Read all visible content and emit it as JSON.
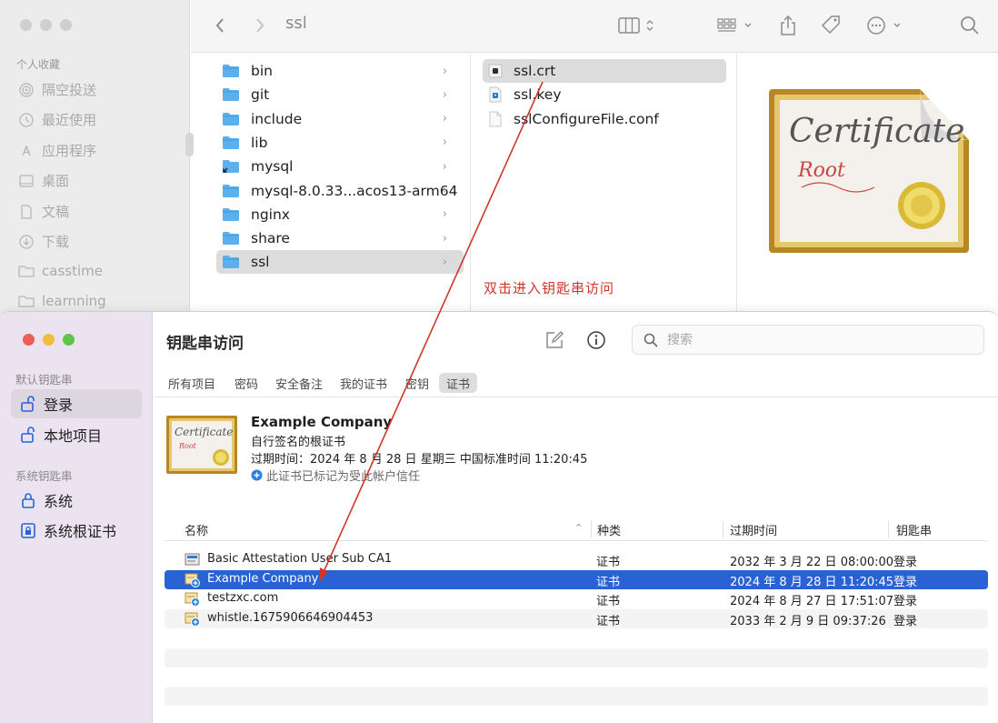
{
  "finder": {
    "title": "ssl",
    "sidebar": {
      "section": "个人收藏",
      "items": [
        {
          "label": "隔空投送",
          "icon": "airdrop-icon"
        },
        {
          "label": "最近使用",
          "icon": "clock-icon"
        },
        {
          "label": "应用程序",
          "icon": "applications-icon"
        },
        {
          "label": "桌面",
          "icon": "desktop-icon"
        },
        {
          "label": "文稿",
          "icon": "document-icon"
        },
        {
          "label": "下载",
          "icon": "download-icon"
        },
        {
          "label": "casstime",
          "icon": "folder-icon"
        },
        {
          "label": "learnning",
          "icon": "folder-icon"
        }
      ]
    },
    "column1": [
      {
        "name": "bin"
      },
      {
        "name": "git"
      },
      {
        "name": "include"
      },
      {
        "name": "lib"
      },
      {
        "name": "mysql"
      },
      {
        "name": "mysql-8.0.33...acos13-arm64"
      },
      {
        "name": "nginx"
      },
      {
        "name": "share"
      },
      {
        "name": "ssl",
        "selected": true
      }
    ],
    "column2": [
      {
        "name": "ssl.crt",
        "selected": true
      },
      {
        "name": "ssl.key"
      },
      {
        "name": "sslConfigureFile.conf"
      }
    ],
    "preview": {
      "line1": "Certificate",
      "line2": "Root"
    }
  },
  "annotation": "双击进入钥匙串访问",
  "keychain": {
    "title": "钥匙串访问",
    "sidebar": {
      "default_section": "默认钥匙串",
      "default_items": [
        {
          "label": "登录",
          "icon": "unlock-icon",
          "selected": true
        },
        {
          "label": "本地项目",
          "icon": "unlock-icon"
        }
      ],
      "system_section": "系统钥匙串",
      "system_items": [
        {
          "label": "系统",
          "icon": "lock-icon"
        },
        {
          "label": "系统根证书",
          "icon": "lock-cabinet-icon"
        }
      ]
    },
    "search_placeholder": "搜索",
    "tabs": [
      "所有项目",
      "密码",
      "安全备注",
      "我的证书",
      "密钥",
      "证书"
    ],
    "selected_tab": "证书",
    "summary": {
      "name": "Example Company",
      "type": "自行签名的根证书",
      "expires": "过期时间：2024 年 8 月 28 日 星期三 中国标准时间 11:20:45",
      "trust": "此证书已标记为受此帐户信任",
      "thumb_line1": "Certificate",
      "thumb_line2": "Root"
    },
    "table": {
      "headers": [
        "名称",
        "种类",
        "过期时间",
        "钥匙串"
      ],
      "rows": [
        {
          "name": "Basic Attestation User Sub CA1",
          "kind": "证书",
          "expires": "2032 年 3 月 22 日 08:00:00",
          "keychain": "登录"
        },
        {
          "name": "Example Company",
          "kind": "证书",
          "expires": "2024 年 8 月 28 日 11:20:45",
          "keychain": "登录",
          "selected": true
        },
        {
          "name": "testzxc.com",
          "kind": "证书",
          "expires": "2024 年 8 月 27 日 17:51:07",
          "keychain": "登录"
        },
        {
          "name": "whistle.1675906646904453",
          "kind": "证书",
          "expires": "2033 年 2 月 9 日 09:37:26",
          "keychain": "登录"
        }
      ]
    }
  },
  "colors": {
    "selection_blue": "#2a62d5",
    "annotation_red": "#d0352c",
    "traffic_red": "#ec5f57",
    "traffic_yellow": "#f2bd3d",
    "traffic_green": "#5ec44c"
  }
}
